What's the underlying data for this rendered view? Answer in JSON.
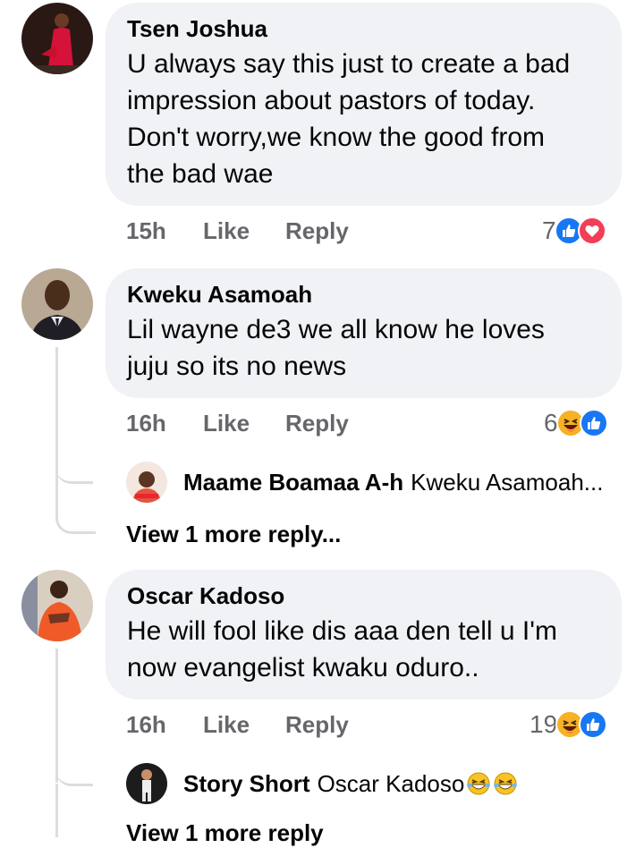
{
  "comments": [
    {
      "name": "Tsen Joshua",
      "lines": [
        "U always say this just to create a bad",
        "impression about pastors of today.",
        "Don't worry,we know the good from",
        "the bad wae"
      ],
      "time": "15h",
      "like": "Like",
      "reply": "Reply",
      "reaction_count": "7",
      "reactions": [
        "like-icon",
        "love-icon"
      ]
    },
    {
      "name": "Kweku Asamoah",
      "lines": [
        "Lil wayne de3 we all know he loves",
        "juju so its no news"
      ],
      "time": "16h",
      "like": "Like",
      "reply": "Reply",
      "reaction_count": "6",
      "reactions": [
        "haha-icon",
        "like-icon"
      ],
      "reply_preview": {
        "name": "Maame Boamaa A-h",
        "text": "Kweku Asamoah..."
      },
      "view_more": "View 1 more reply..."
    },
    {
      "name": "Oscar Kadoso",
      "lines": [
        "He will fool like dis aaa den tell u I'm",
        "now evangelist kwaku oduro.."
      ],
      "time": "16h",
      "like": "Like",
      "reply": "Reply",
      "reaction_count": "19",
      "reactions": [
        "haha-icon",
        "like-icon"
      ],
      "reply_preview": {
        "name": "Story Short",
        "text": "Oscar Kadoso"
      },
      "view_more": "View 1 more reply"
    }
  ],
  "colors": {
    "like_blue": "#1877f2",
    "love_red": "#f33e58",
    "haha_yellow": "#f7b125",
    "bubble": "#f0f2f5",
    "meta_gray": "#65676b"
  }
}
